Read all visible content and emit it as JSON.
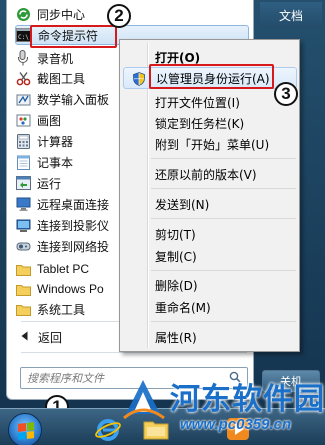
{
  "start_menu": {
    "right_pane_top_item": "文档",
    "programs": [
      {
        "label": "同步中心",
        "icon": "sync-center-icon"
      },
      {
        "label": "命令提示符",
        "icon": "cmd-icon",
        "highlighted": true
      },
      {
        "label": "录音机",
        "icon": "microphone-icon"
      },
      {
        "label": "截图工具",
        "icon": "scissors-icon"
      },
      {
        "label": "数学输入面板",
        "icon": "math-input-icon"
      },
      {
        "label": "画图",
        "icon": "paint-icon"
      },
      {
        "label": "计算器",
        "icon": "calculator-icon"
      },
      {
        "label": "记事本",
        "icon": "notepad-icon"
      },
      {
        "label": "运行",
        "icon": "run-icon"
      },
      {
        "label": "远程桌面连接",
        "icon": "remote-desktop-icon"
      },
      {
        "label": "连接到投影仪",
        "icon": "projector-icon"
      },
      {
        "label": "连接到网络投",
        "icon": "network-projector-icon"
      },
      {
        "label": "Tablet PC",
        "icon": "folder-icon"
      },
      {
        "label": "Windows Po",
        "icon": "folder-icon"
      },
      {
        "label": "系统工具",
        "icon": "folder-icon"
      }
    ],
    "back_label": "返回",
    "back_icon": "left-triangle-icon",
    "search_placeholder": "搜索程序和文件",
    "shutdown_label": "关机"
  },
  "context_menu": {
    "items": [
      {
        "label": "打开(O)",
        "bold": true
      },
      {
        "label": "以管理员身份运行(A)",
        "icon": "uac-shield-icon",
        "highlighted": true
      },
      {
        "label": "打开文件位置(I)"
      },
      {
        "label": "锁定到任务栏(K)"
      },
      {
        "label": "附到「开始」菜单(U)"
      },
      {
        "label": "还原以前的版本(V)"
      },
      {
        "label": "发送到(N)"
      },
      {
        "label": "剪切(T)"
      },
      {
        "label": "复制(C)"
      },
      {
        "label": "删除(D)"
      },
      {
        "label": "重命名(M)"
      },
      {
        "label": "属性(R)"
      }
    ]
  },
  "annotations": {
    "step1": "1",
    "step2": "2",
    "step3": "3",
    "color": "#d7191c"
  },
  "taskbar": {
    "apps": [
      "start-orb",
      "ie-icon",
      "explorer-folder-icon",
      "media-player-icon"
    ]
  },
  "watermark": {
    "title": "河东软件园",
    "url": "www.pc0359.cn"
  },
  "colors": {
    "menu_bg": "#ffffff",
    "context_menu_bg": "#f1f1f1",
    "selection": "#cfe3f6",
    "taskbar": "#1b3d58",
    "watermark_blue": "#1a6fc8"
  }
}
